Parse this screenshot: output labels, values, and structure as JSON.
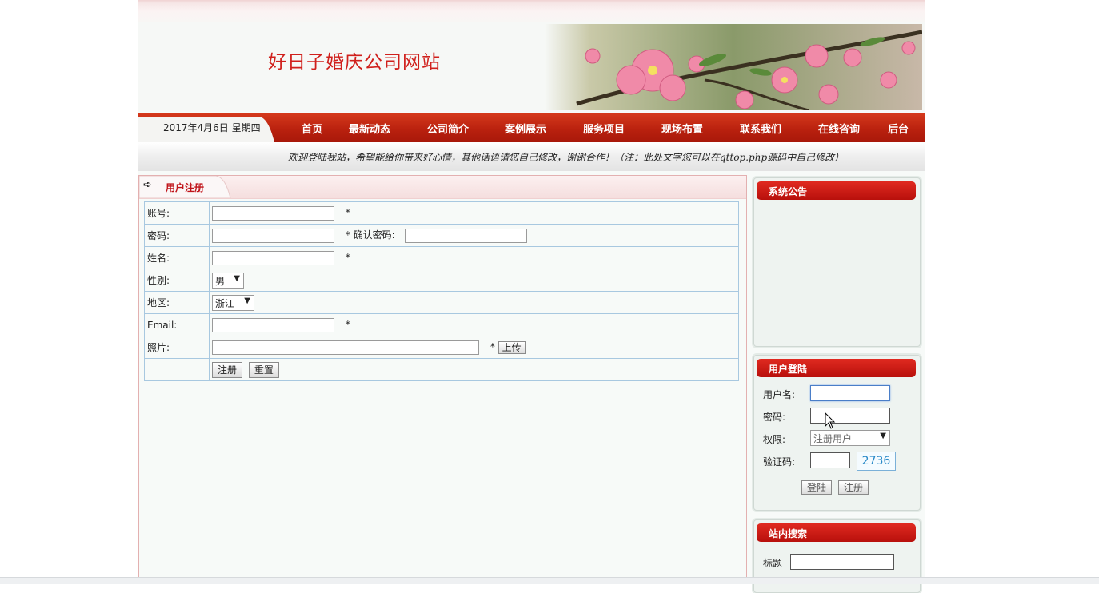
{
  "header": {
    "site_title": "好日子婚庆公司网站"
  },
  "nav": {
    "date": "2017年4月6日  星期四",
    "items": [
      "首页",
      "最新动态",
      "公司简介",
      "案例展示",
      "服务项目",
      "现场布置",
      "联系我们",
      "在线咨询",
      "后台"
    ]
  },
  "marquee": "欢迎登陆我站，希望能给你带来好心情，其他话语请您自己修改，谢谢合作！（注：此处文字您可以在qttop.php源码中自己修改）",
  "register": {
    "title": "用户注册",
    "account_label": "账号:",
    "password_label": "密码:",
    "confirm_label": "确认密码:",
    "name_label": "姓名:",
    "gender_label": "性别:",
    "gender_value": "男",
    "region_label": "地区:",
    "region_value": "浙江",
    "email_label": "Email:",
    "photo_label": "照片:",
    "required_mark": "*",
    "upload_button": "上传",
    "submit_button": "注册",
    "reset_button": "重置"
  },
  "sidebar": {
    "notice_title": "系统公告",
    "login_title": "用户登陆",
    "username_label": "用户名:",
    "password_label": "密码:",
    "role_label": "权限:",
    "role_value": "注册用户",
    "captcha_label": "验证码:",
    "captcha_code": "2736",
    "login_button": "登陆",
    "register_button": "注册",
    "search_title": "站内搜索",
    "search_label": "标题"
  },
  "colors": {
    "brand_red": "#c0141a",
    "nav_red": "#b8200e",
    "form_border": "#a8c8e0"
  }
}
